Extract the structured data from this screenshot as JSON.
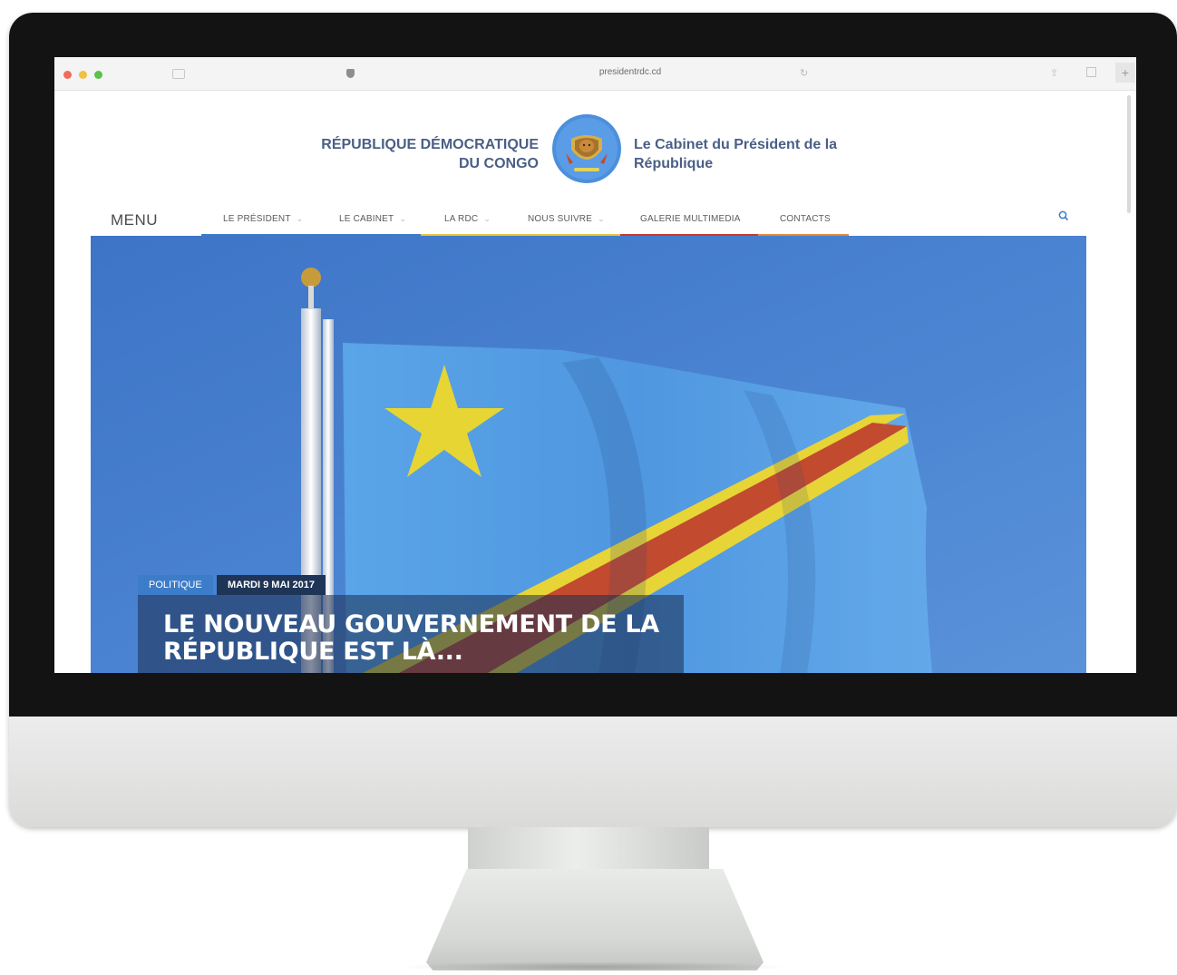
{
  "browser": {
    "url": "presidentrdc.cd"
  },
  "header": {
    "title_left_line1": "RÉPUBLIQUE DÉMOCRATIQUE",
    "title_left_line2": "DU CONGO",
    "title_right_line1": "Le Cabinet du Président de la",
    "title_right_line2": "République"
  },
  "nav": {
    "menu_label": "MENU",
    "items": [
      {
        "label": "LE PRÉSIDENT",
        "has_dropdown": true,
        "underline_color": "#3d7cc9"
      },
      {
        "label": "LE CABINET",
        "has_dropdown": true,
        "underline_color": "#3d7cc9"
      },
      {
        "label": "LA RDC",
        "has_dropdown": true,
        "underline_color": "#e7c83a"
      },
      {
        "label": "NOUS SUIVRE",
        "has_dropdown": true,
        "underline_color": "#e7c83a"
      },
      {
        "label": "GALERIE MULTIMEDIA",
        "has_dropdown": false,
        "underline_color": "#c9382f"
      },
      {
        "label": "CONTACTS",
        "has_dropdown": false,
        "underline_color": "#e38b3a"
      }
    ],
    "search_icon": "search-icon"
  },
  "hero": {
    "category": "POLITIQUE",
    "date": "MARDI 9 MAI 2017",
    "headline_line1": "LE NOUVEAU GOUVERNEMENT DE LA",
    "headline_line2": "RÉPUBLIQUE EST LÀ..."
  },
  "colors": {
    "brand_text": "#4a5f86",
    "sky": "#4d86d1",
    "flag_blue": "#5aa3e6",
    "flag_red": "#c24a2f",
    "flag_yellow": "#e6d533",
    "badge_category": "#3d7cc9",
    "badge_date": "#1f3557"
  }
}
